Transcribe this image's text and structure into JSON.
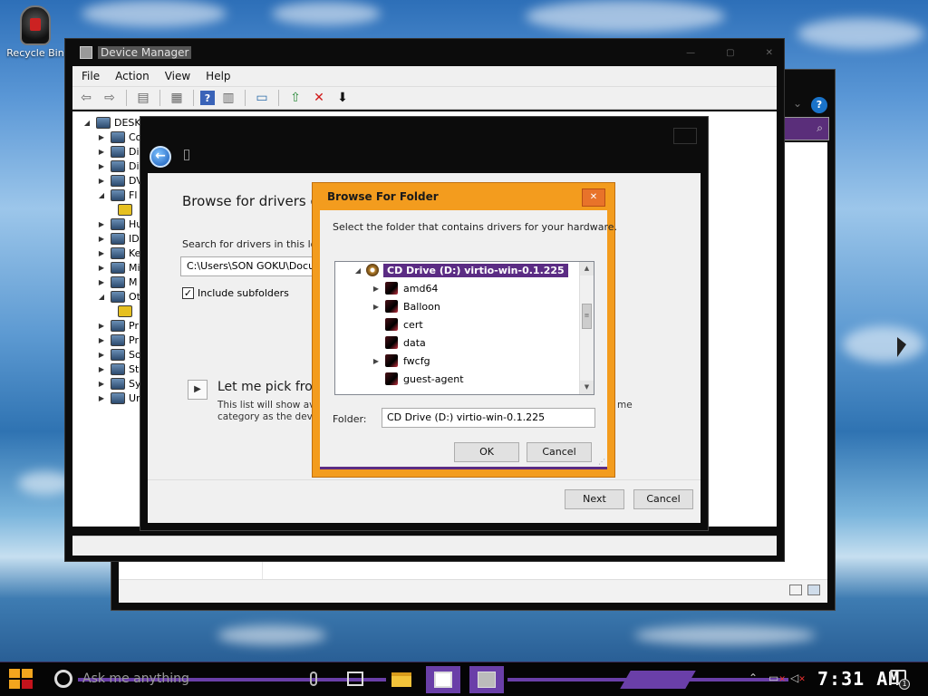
{
  "desktop": {
    "icons": [
      {
        "label": "Recycle Bin",
        "icon": "recycle-bin-icon"
      }
    ]
  },
  "device_manager": {
    "title": "Device Manager",
    "menu": [
      "File",
      "Action",
      "View",
      "Help"
    ],
    "tree": [
      {
        "label": "DESKT",
        "expander": "◢"
      },
      {
        "label": "Co",
        "expander": "▶"
      },
      {
        "label": "Di",
        "expander": "▶"
      },
      {
        "label": "Di",
        "expander": "▶"
      },
      {
        "label": "DV",
        "expander": "▶"
      },
      {
        "label": "Fl",
        "expander": "◢"
      },
      {
        "label": "",
        "expander": ""
      },
      {
        "label": "Hu",
        "expander": "▶"
      },
      {
        "label": "ID",
        "expander": "▶"
      },
      {
        "label": "Ke",
        "expander": "▶"
      },
      {
        "label": "Mi",
        "expander": "▶"
      },
      {
        "label": "M",
        "expander": "▶"
      },
      {
        "label": "Ot",
        "expander": "◢"
      },
      {
        "label": "",
        "expander": ""
      },
      {
        "label": "Pr",
        "expander": "▶"
      },
      {
        "label": "Pr",
        "expander": "▶"
      },
      {
        "label": "So",
        "expander": "▶"
      },
      {
        "label": "St",
        "expander": "▶"
      },
      {
        "label": "Sy",
        "expander": "▶"
      },
      {
        "label": "Ur",
        "expander": "▶"
      }
    ]
  },
  "wizard": {
    "heading": "Browse for drivers on",
    "search_label": "Search for drivers in this loc",
    "path_value": "C:\\Users\\SON GOKU\\Docu",
    "include_subfolders": "Include subfolders",
    "pick_heading": "Let me pick from",
    "pick_desc_1": "This list will show ava",
    "pick_desc_2": "category as the devic",
    "pick_desc_right": "me",
    "next": "Next",
    "cancel": "Cancel"
  },
  "browse_dialog": {
    "title": "Browse For Folder",
    "description": "Select the folder that contains drivers for your hardware.",
    "root": "CD Drive (D:) virtio-win-0.1.225",
    "folders": [
      {
        "name": "amd64",
        "expandable": true
      },
      {
        "name": "Balloon",
        "expandable": true
      },
      {
        "name": "cert",
        "expandable": false
      },
      {
        "name": "data",
        "expandable": false
      },
      {
        "name": "fwcfg",
        "expandable": true
      },
      {
        "name": "guest-agent",
        "expandable": false
      }
    ],
    "folder_label": "Folder:",
    "folder_value": "CD Drive (D:) virtio-win-0.1.225",
    "ok": "OK",
    "cancel": "Cancel"
  },
  "taskbar": {
    "search_placeholder": "Ask me anything",
    "clock": "7:31 AM",
    "notification_count": "1",
    "accent": "#6a3fa8"
  }
}
